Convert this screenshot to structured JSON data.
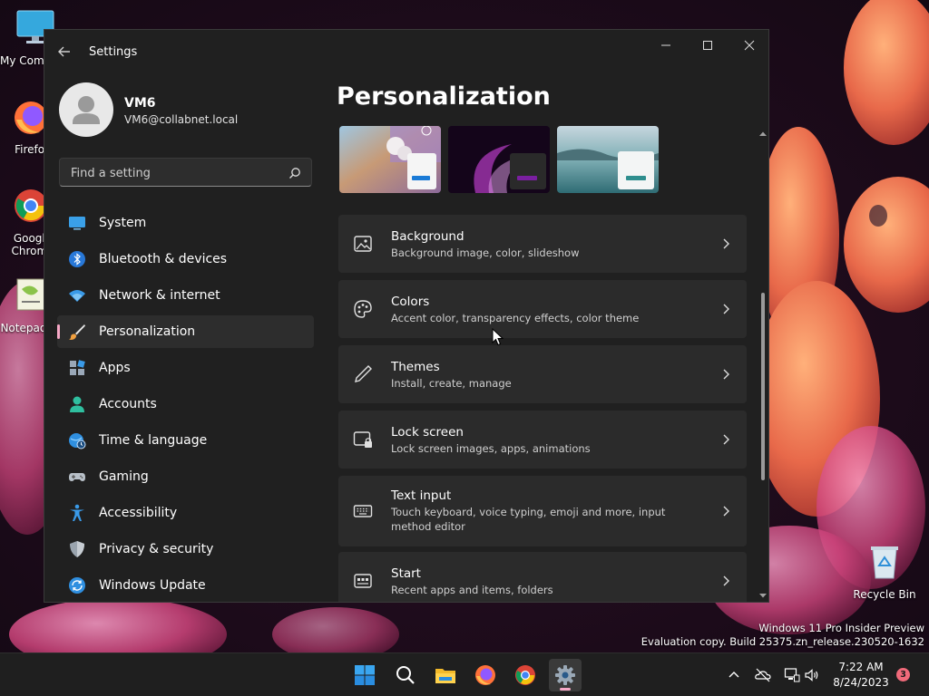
{
  "desktop": {
    "icons": [
      {
        "label": "My Computer",
        "icon": "monitor-icon"
      },
      {
        "label": "Firefox",
        "icon": "firefox-icon"
      },
      {
        "label": "Google Chrome",
        "icon": "chrome-icon"
      },
      {
        "label": "Notepad++",
        "icon": "notepad-icon"
      }
    ],
    "recycle_bin": {
      "label": "Recycle Bin",
      "icon": "recycle-bin-icon"
    },
    "watermark": {
      "line1": "Windows 11 Pro Insider Preview",
      "line2": "Evaluation copy. Build 25375.zn_release.230520-1632"
    }
  },
  "window": {
    "title": "Settings",
    "back_icon": "back-arrow-icon",
    "controls": {
      "minimize": "minimize-icon",
      "maximize": "maximize-icon",
      "close": "close-icon"
    }
  },
  "user": {
    "name": "VM6",
    "email": "VM6@collabnet.local",
    "avatar": "user-avatar-icon"
  },
  "search": {
    "placeholder": "Find a setting",
    "value": "",
    "icon": "search-icon"
  },
  "nav": [
    {
      "label": "System",
      "icon": "system-icon",
      "active": false
    },
    {
      "label": "Bluetooth & devices",
      "icon": "bluetooth-icon",
      "active": false
    },
    {
      "label": "Network & internet",
      "icon": "wifi-icon",
      "active": false
    },
    {
      "label": "Personalization",
      "icon": "brush-icon",
      "active": true
    },
    {
      "label": "Apps",
      "icon": "apps-icon",
      "active": false
    },
    {
      "label": "Accounts",
      "icon": "account-icon",
      "active": false
    },
    {
      "label": "Time & language",
      "icon": "globe-clock-icon",
      "active": false
    },
    {
      "label": "Gaming",
      "icon": "gamepad-icon",
      "active": false
    },
    {
      "label": "Accessibility",
      "icon": "accessibility-icon",
      "active": false
    },
    {
      "label": "Privacy & security",
      "icon": "shield-icon",
      "active": false
    },
    {
      "label": "Windows Update",
      "icon": "update-icon",
      "active": false
    }
  ],
  "page": {
    "title": "Personalization",
    "cards": [
      {
        "title": "Background",
        "subtitle": "Background image, color, slideshow",
        "icon": "image-icon"
      },
      {
        "title": "Colors",
        "subtitle": "Accent color, transparency effects, color theme",
        "icon": "palette-icon"
      },
      {
        "title": "Themes",
        "subtitle": "Install, create, manage",
        "icon": "pen-icon"
      },
      {
        "title": "Lock screen",
        "subtitle": "Lock screen images, apps, animations",
        "icon": "lock-screen-icon"
      },
      {
        "title": "Text input",
        "subtitle": "Touch keyboard, voice typing, emoji and more, input method editor",
        "icon": "keyboard-icon"
      },
      {
        "title": "Start",
        "subtitle": "Recent apps and items, folders",
        "icon": "start-icon"
      }
    ]
  },
  "taskbar": {
    "apps": [
      "windows-start-icon",
      "search-icon",
      "file-explorer-icon",
      "firefox-icon",
      "chrome-icon",
      "settings-gear-icon"
    ],
    "time": "7:22 AM",
    "date": "8/24/2023",
    "notification_count": "3"
  }
}
